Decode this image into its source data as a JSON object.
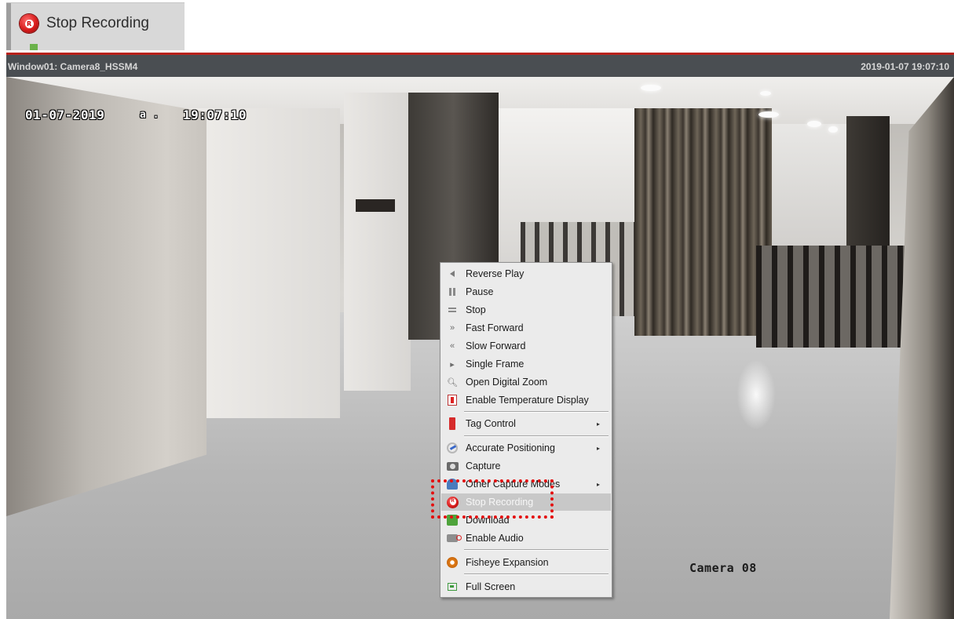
{
  "inset": {
    "label": "Stop Recording",
    "icon": "record-icon"
  },
  "window": {
    "title": "Window01: Camera8_HSSM4",
    "timestamp": "2019-01-07 19:07:10"
  },
  "video": {
    "osd_date": "01-07-2019",
    "osd_sep": "a .",
    "osd_time": "19:07:10",
    "osd_camera": "Camera 08"
  },
  "context_menu": {
    "items": [
      {
        "label": "Reverse Play",
        "icon": "reverse-play-icon"
      },
      {
        "label": "Pause",
        "icon": "pause-icon"
      },
      {
        "label": "Stop",
        "icon": "stop-icon"
      },
      {
        "label": "Fast Forward",
        "icon": "fast-forward-icon"
      },
      {
        "label": "Slow Forward",
        "icon": "slow-forward-icon"
      },
      {
        "label": "Single Frame",
        "icon": "single-frame-icon"
      },
      {
        "label": "Open Digital Zoom",
        "icon": "zoom-icon"
      },
      {
        "label": "Enable Temperature Display",
        "icon": "thermometer-icon"
      },
      {
        "label": "Tag Control",
        "icon": "tag-icon",
        "submenu": true
      },
      {
        "label": "Accurate Positioning",
        "icon": "positioning-icon",
        "submenu": true
      },
      {
        "label": "Capture",
        "icon": "camera-icon"
      },
      {
        "label": "Other Capture Modes",
        "icon": "capture-modes-icon",
        "submenu": true
      },
      {
        "label": "Stop Recording",
        "icon": "record-icon",
        "highlighted": true
      },
      {
        "label": "Download",
        "icon": "download-icon"
      },
      {
        "label": "Enable Audio",
        "icon": "audio-icon"
      },
      {
        "label": "Fisheye Expansion",
        "icon": "fisheye-icon"
      },
      {
        "label": "Full Screen",
        "icon": "fullscreen-icon"
      }
    ],
    "submenu_arrow": "▸"
  },
  "colors": {
    "title_bar": "#4a4e52",
    "title_bar_accent": "#b8221c",
    "annotation": "#e41010",
    "menu_bg": "#ebebeb",
    "menu_highlight": "#c8c8c8"
  }
}
